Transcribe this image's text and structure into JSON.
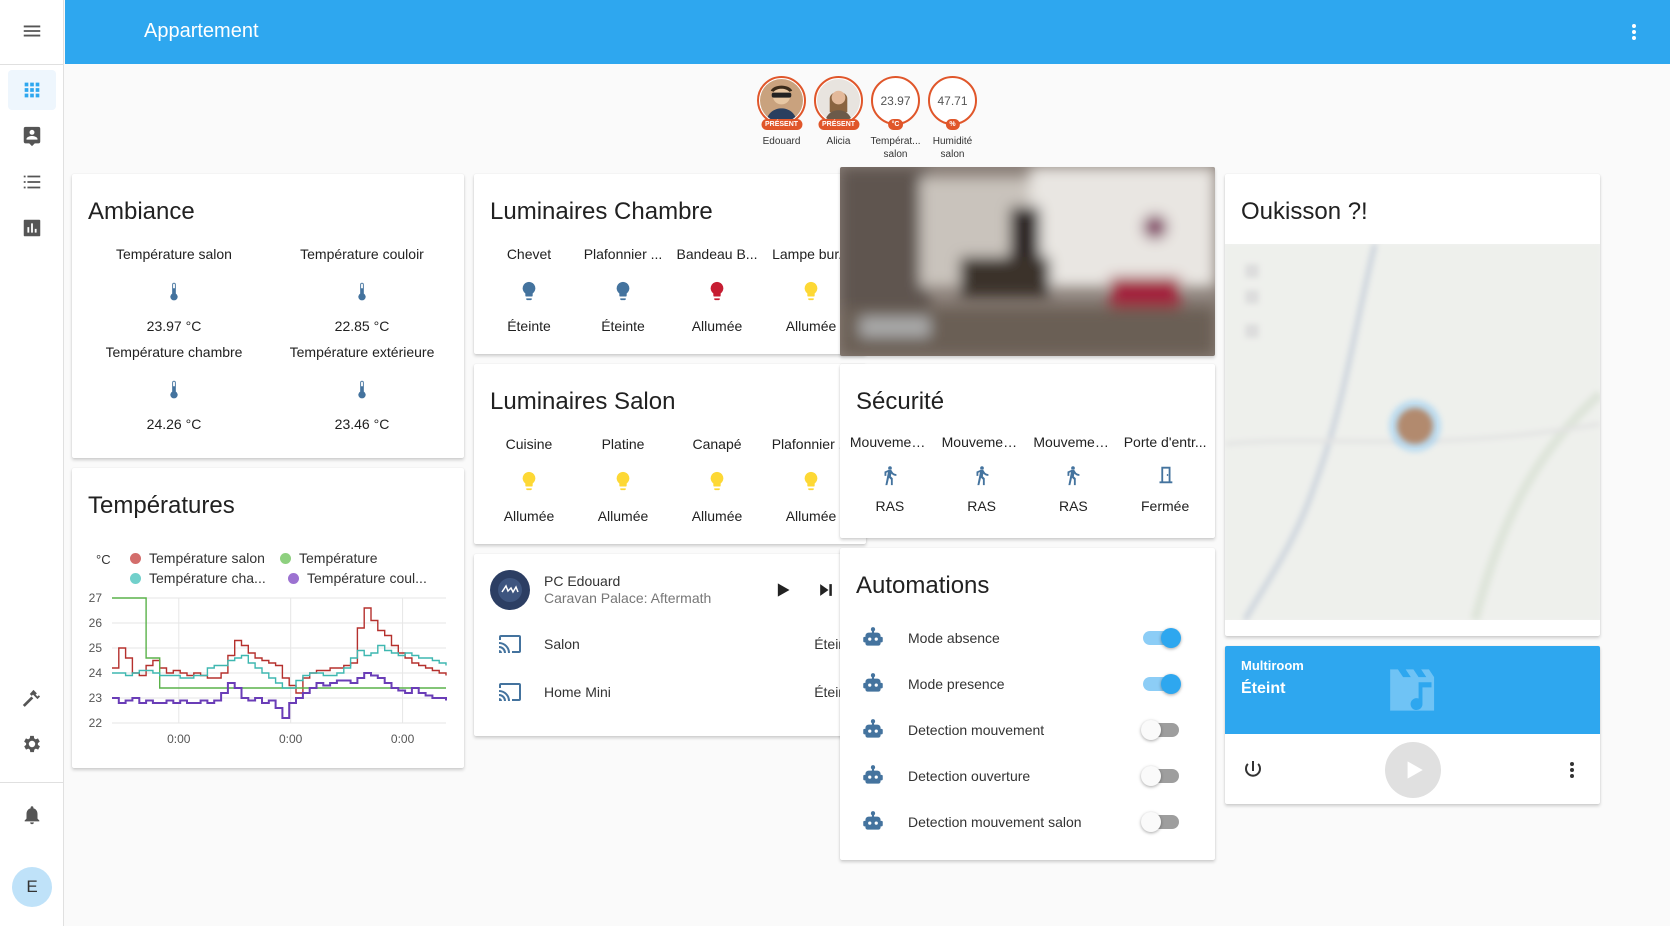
{
  "header": {
    "title": "Appartement"
  },
  "sidebar": {
    "items": [
      {
        "icon": "menu-icon"
      },
      {
        "icon": "dashboard-grid-icon"
      },
      {
        "icon": "map-person-icon"
      },
      {
        "icon": "logbook-list-icon"
      },
      {
        "icon": "history-chart-icon"
      },
      {
        "icon": "hammer-icon"
      },
      {
        "icon": "settings-gear-icon"
      },
      {
        "icon": "bell-icon"
      }
    ],
    "user_initial": "E"
  },
  "badges": [
    {
      "label": "Edouard",
      "tag": "PRÉSENT",
      "kind": "person"
    },
    {
      "label": "Alicia",
      "tag": "PRÉSENT",
      "kind": "person"
    },
    {
      "label": "Températ... salon",
      "value": "23.97",
      "tag": "°C",
      "kind": "sensor"
    },
    {
      "label": "Humidité salon",
      "value": "47.71",
      "tag": "%",
      "kind": "sensor"
    }
  ],
  "ambiance": {
    "title": "Ambiance",
    "entities": [
      {
        "name": "Température salon",
        "state": "23.97 °C",
        "icon": "thermometer-icon"
      },
      {
        "name": "Température couloir",
        "state": "22.85 °C",
        "icon": "thermometer-icon"
      },
      {
        "name": "Température chambre",
        "state": "24.26 °C",
        "icon": "thermometer-icon"
      },
      {
        "name": "Température extérieure",
        "state": "23.46 °C",
        "icon": "thermometer-icon"
      }
    ]
  },
  "temperatures": {
    "title": "Températures",
    "unit": "°C",
    "legend": [
      "Température salon",
      "Température",
      "Température cha...",
      "Température coul..."
    ]
  },
  "chart_data": {
    "type": "line",
    "title": "Températures",
    "ylabel": "°C",
    "ylim": [
      22,
      27
    ],
    "yticks": [
      27,
      26,
      25,
      24,
      23,
      22
    ],
    "xticks": [
      "0:00",
      "0:00",
      "0:00"
    ],
    "grid": true,
    "legend_position": "top",
    "series": [
      {
        "name": "Température salon",
        "color": "#b5302d",
        "values": [
          24.2,
          25.0,
          24.6,
          24.0,
          23.9,
          24.3,
          24.5,
          24.2,
          24.0,
          24.1,
          24.0,
          23.9,
          24.0,
          23.9,
          23.8,
          23.8,
          24.0,
          24.7,
          25.3,
          25.1,
          24.8,
          24.6,
          24.5,
          24.4,
          24.3,
          23.8,
          23.5,
          23.2,
          23.8,
          24.0,
          24.1,
          24.1,
          24.2,
          24.2,
          24.3,
          24.4,
          25.8,
          26.6,
          26.1,
          25.7,
          25.5,
          25.1,
          24.8,
          24.6,
          24.4,
          24.3,
          24.2,
          24.1,
          24.0,
          23.9
        ]
      },
      {
        "name": "Température",
        "color": "#5ab24a",
        "values": [
          27.0,
          27.0,
          27.0,
          27.0,
          27.0,
          24.6,
          24.6,
          23.4,
          23.4,
          23.4,
          23.4,
          23.4,
          23.4,
          23.4,
          23.4,
          23.4,
          23.4,
          23.4,
          23.4,
          23.4,
          23.4,
          23.4,
          23.4,
          23.4,
          23.4,
          23.4,
          23.4,
          23.4,
          23.4,
          23.4,
          23.4,
          23.4,
          23.4,
          23.4,
          23.4,
          23.4,
          23.4,
          23.4,
          23.4,
          23.4,
          23.4,
          23.4,
          23.4,
          23.4,
          23.4,
          23.4,
          23.4,
          23.4,
          23.4,
          23.4
        ]
      },
      {
        "name": "Température cha...",
        "color": "#3eb7b0",
        "values": [
          24.0,
          24.0,
          23.9,
          24.0,
          24.1,
          24.1,
          24.0,
          23.9,
          23.9,
          23.9,
          23.8,
          23.8,
          23.9,
          23.9,
          24.2,
          24.3,
          24.3,
          24.5,
          24.6,
          24.7,
          24.4,
          24.2,
          24.0,
          23.8,
          23.6,
          23.4,
          23.4,
          23.7,
          23.9,
          24.0,
          24.0,
          23.9,
          23.9,
          24.0,
          24.2,
          24.6,
          24.9,
          24.7,
          24.8,
          25.1,
          24.9,
          24.8,
          24.7,
          24.8,
          24.7,
          24.6,
          24.6,
          24.5,
          24.4,
          24.3
        ]
      },
      {
        "name": "Température coul...",
        "color": "#6a3db7",
        "values": [
          23.0,
          22.8,
          22.9,
          23.0,
          22.8,
          22.9,
          22.8,
          22.8,
          22.9,
          22.8,
          22.9,
          22.8,
          22.8,
          22.9,
          22.8,
          22.9,
          23.2,
          23.6,
          23.4,
          23.0,
          22.9,
          23.0,
          22.8,
          22.9,
          22.6,
          22.2,
          22.8,
          23.0,
          23.2,
          23.4,
          23.6,
          23.5,
          23.6,
          23.7,
          23.7,
          23.6,
          23.8,
          24.0,
          23.9,
          23.8,
          23.6,
          23.4,
          23.3,
          23.2,
          23.4,
          23.2,
          23.1,
          23.0,
          23.0,
          22.9
        ]
      }
    ]
  },
  "luminaires_chambre": {
    "title": "Luminaires Chambre",
    "entities": [
      {
        "name": "Chevet",
        "state": "Éteinte",
        "icon": "lightbulb-icon",
        "color": "#44739e"
      },
      {
        "name": "Plafonnier ...",
        "state": "Éteinte",
        "icon": "lightbulb-icon",
        "color": "#44739e"
      },
      {
        "name": "Bandeau B...",
        "state": "Allumée",
        "icon": "lightbulb-icon",
        "color": "#c61d32"
      },
      {
        "name": "Lampe bur...",
        "state": "Allumée",
        "icon": "lightbulb-icon",
        "color": "#fdd835"
      }
    ]
  },
  "luminaires_salon": {
    "title": "Luminaires Salon",
    "entities": [
      {
        "name": "Cuisine",
        "state": "Allumée",
        "icon": "lightbulb-icon",
        "color": "#fdd835"
      },
      {
        "name": "Platine",
        "state": "Allumée",
        "icon": "lightbulb-icon",
        "color": "#fdd835"
      },
      {
        "name": "Canapé",
        "state": "Allumée",
        "icon": "lightbulb-icon",
        "color": "#fdd835"
      },
      {
        "name": "Plafonnier ...",
        "state": "Allumée",
        "icon": "lightbulb-icon",
        "color": "#fdd835"
      }
    ]
  },
  "media": {
    "player": {
      "name": "PC Edouard",
      "track": "Caravan Palace: Aftermath"
    },
    "devices": [
      {
        "name": "Salon",
        "state": "Éteint",
        "icon": "cast-icon"
      },
      {
        "name": "Home Mini",
        "state": "Éteint",
        "icon": "cast-icon"
      }
    ]
  },
  "securite": {
    "title": "Sécurité",
    "entities": [
      {
        "name": "Mouvemen...",
        "state": "RAS",
        "icon": "walk-icon"
      },
      {
        "name": "Mouvemen...",
        "state": "RAS",
        "icon": "walk-icon"
      },
      {
        "name": "Mouvemen...",
        "state": "RAS",
        "icon": "walk-icon"
      },
      {
        "name": "Porte d'entr...",
        "state": "Fermée",
        "icon": "door-closed-icon"
      }
    ]
  },
  "automations": {
    "title": "Automations",
    "items": [
      {
        "name": "Mode absence",
        "on": true
      },
      {
        "name": "Mode presence",
        "on": true
      },
      {
        "name": "Detection mouvement",
        "on": false
      },
      {
        "name": "Detection ouverture",
        "on": false
      },
      {
        "name": "Detection mouvement salon",
        "on": false
      }
    ]
  },
  "map_card": {
    "title": "Oukisson ?!"
  },
  "multiroom": {
    "title": "Multiroom",
    "state": "Éteint"
  },
  "colors": {
    "primary": "#2ea7ef",
    "icon_default": "#44739e",
    "badge": "#e0562a"
  }
}
